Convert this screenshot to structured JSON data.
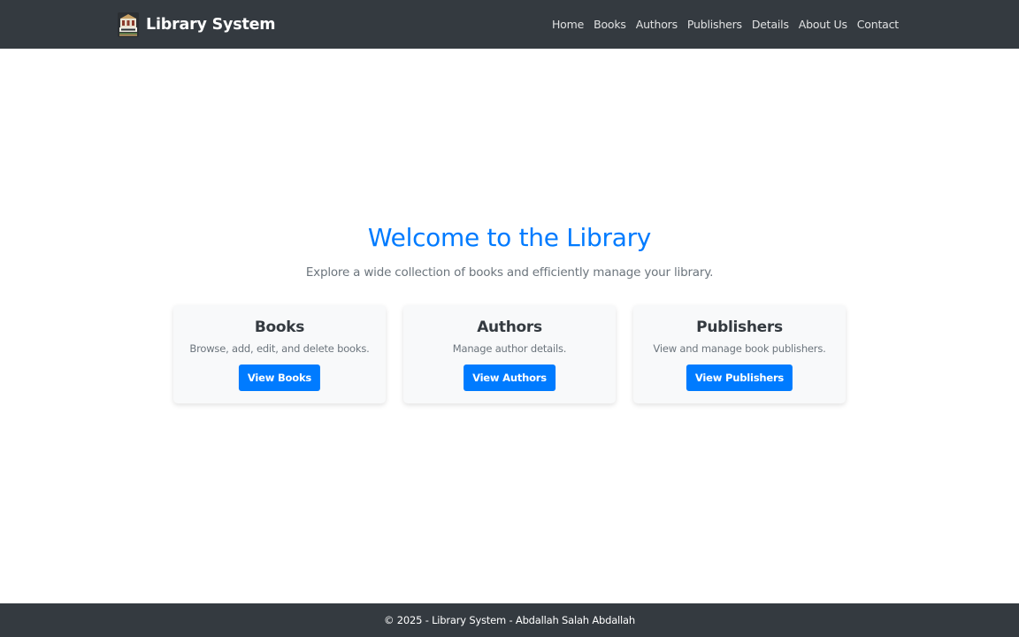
{
  "header": {
    "brand_name": "Library System",
    "logo_icon": "library-building-icon",
    "nav_items": [
      {
        "label": "Home"
      },
      {
        "label": "Books"
      },
      {
        "label": "Authors"
      },
      {
        "label": "Publishers"
      },
      {
        "label": "Details"
      },
      {
        "label": "About Us"
      },
      {
        "label": "Contact"
      }
    ]
  },
  "hero": {
    "title": "Welcome to the Library",
    "subtitle": "Explore a wide collection of books and efficiently manage your library."
  },
  "cards": [
    {
      "title": "Books",
      "text": "Browse, add, edit, and delete books.",
      "button": "View Books"
    },
    {
      "title": "Authors",
      "text": "Manage author details.",
      "button": "View Authors"
    },
    {
      "title": "Publishers",
      "text": "View and manage book publishers.",
      "button": "View Publishers"
    }
  ],
  "footer": {
    "text": "© 2025 - Library System - Abdallah Salah Abdallah"
  },
  "colors": {
    "navbar_bg": "#343a40",
    "primary": "#007bff",
    "muted_text": "#6c757d",
    "card_bg": "#f8f9fa"
  }
}
